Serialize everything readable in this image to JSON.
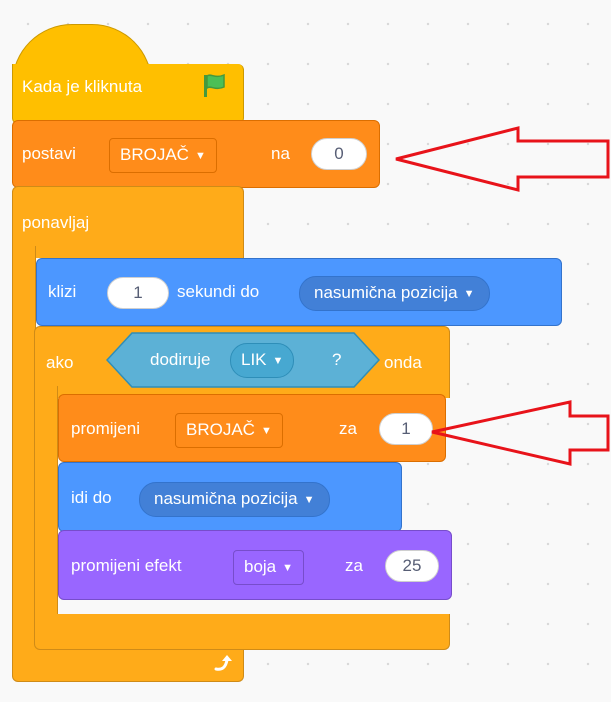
{
  "script": {
    "hat": {
      "label": "Kada je kliknuta",
      "icon": "green-flag-icon"
    },
    "set_var": {
      "label": "postavi",
      "variable": "BROJAČ",
      "connector": "na",
      "value": "0"
    },
    "repeat": {
      "label": "ponavljaj",
      "icon": "loop-arrow-icon"
    },
    "glide": {
      "label": "klizi",
      "seconds": "1",
      "label2": "sekundi do",
      "target": "nasumična pozicija"
    },
    "if_block": {
      "label": "ako",
      "then_label": "onda"
    },
    "touching": {
      "label": "dodiruje",
      "object": "LIK",
      "question": "?"
    },
    "change_var": {
      "label": "promijeni",
      "variable": "BROJAČ",
      "connector": "za",
      "value": "1"
    },
    "goto": {
      "label": "idi do",
      "target": "nasumična pozicija"
    },
    "change_effect": {
      "label": "promijeni efekt",
      "effect": "boja",
      "connector": "za",
      "value": "25"
    }
  },
  "annotations": {
    "arrow_color": "#E8131A",
    "arrows": [
      {
        "name": "arrow-to-set-variable",
        "points_to": "set_var"
      },
      {
        "name": "arrow-to-change-variable",
        "points_to": "change_var"
      }
    ]
  },
  "colors": {
    "events": "#FFBF00",
    "control": "#FFAB19",
    "variables": "#FF8C1A",
    "motion": "#4C97FF",
    "sensing": "#5CB1D6",
    "looks": "#9966FF"
  }
}
